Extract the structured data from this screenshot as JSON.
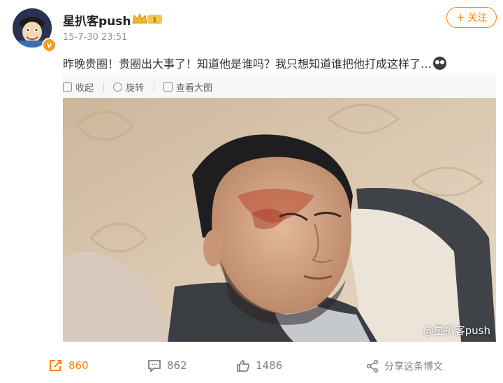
{
  "post": {
    "username": "星扒客push",
    "vip_badge": "1",
    "timestamp": "15-7-30 23:51",
    "follow_label": "关注",
    "text": "昨晚贵圈！贵圈出大事了！知道他是谁吗？我只想知道谁把他打成这样了…",
    "emoji": "doge-emoji"
  },
  "toolbar": {
    "collapse_label": "收起",
    "rotate_label": "旋转",
    "view_large_label": "查看大图"
  },
  "image": {
    "watermark": "@星扒客push",
    "description_icon": "photo"
  },
  "actions": {
    "repost_count": "860",
    "comment_count": "862",
    "like_count": "1486",
    "share_label": "分享这条博文"
  },
  "colors": {
    "accent": "#ff8200",
    "verified": "#f59c23",
    "muted": "#939393"
  }
}
